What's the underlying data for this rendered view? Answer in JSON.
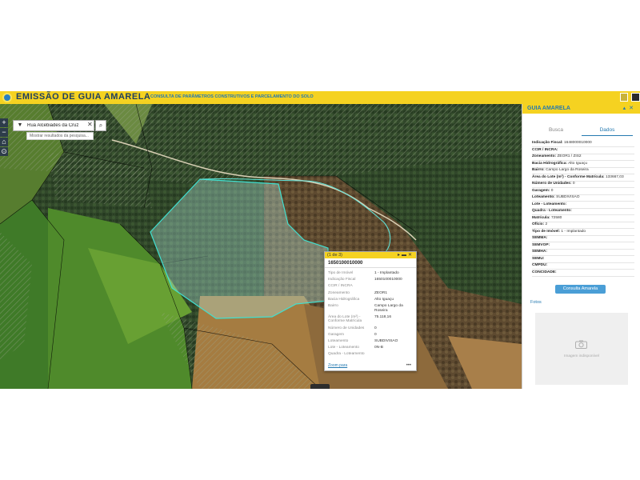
{
  "header": {
    "title": "EMISSÃO DE GUIA AMARELA",
    "subtitle": "CONSULTA DE PARÂMETROS CONSTRUTIVOS E PARCELAMENTO DO SOLO"
  },
  "map_controls": [
    "+",
    "−",
    "⌂",
    "⊙"
  ],
  "search": {
    "value": "Rua Alcebiades da Cruz",
    "hint": "Mostrar resultados da pesquisa..."
  },
  "popup": {
    "count": "(1 de 3)",
    "title": "1650100010000",
    "rows": [
      {
        "label": "Tipo de Imóvel",
        "value": "1 - Implantado"
      },
      {
        "label": "Indicação Fiscal",
        "value": "1650100010000"
      },
      {
        "label": "CCIR / INCRA",
        "value": ""
      },
      {
        "label": "Zoneamento",
        "value": "ZEOR1"
      },
      {
        "label": "Bacia Hidrográfica",
        "value": "Alto Iguaçu"
      },
      {
        "label": "Bairro",
        "value": "Campo Largo da Roseira"
      },
      {
        "label": "Área do Lote (m²) - Conforme Matrícula",
        "value": "75.118,16"
      },
      {
        "label": "Número de Unidades",
        "value": "0"
      },
      {
        "label": "Garagem",
        "value": "0"
      },
      {
        "label": "Loteamento",
        "value": "SUBDIVISAO"
      },
      {
        "label": "Lote - Loteamento",
        "value": "0N-B"
      },
      {
        "label": "Quadra - Loteamento",
        "value": ""
      }
    ],
    "zoom_link": "Zoom para",
    "more": "•••"
  },
  "panel": {
    "title": "GUIA AMARELA",
    "tabs": [
      "Busca",
      "Dados"
    ],
    "details": [
      {
        "key": "Indicação Fiscal:",
        "value": " 1648000010000"
      },
      {
        "key": "CCIR / INCRA:",
        "value": ""
      },
      {
        "key": "Zoneamento:",
        "value": " ZEOR1 / ZIS2"
      },
      {
        "key": "Bacia Hidrográfica:",
        "value": " Alto Iguaçu"
      },
      {
        "key": "Bairro:",
        "value": " Campo Largo da Roseira"
      },
      {
        "key": "Área do Lote (m²) - Conforme Matrícula:",
        "value": " 133667,03"
      },
      {
        "key": "Número de Unidades:",
        "value": " 0"
      },
      {
        "key": "Garagem:",
        "value": " 0"
      },
      {
        "key": "Loteamento:",
        "value": " SUBDIVISAO"
      },
      {
        "key": "Lote - Loteamento:",
        "value": ""
      },
      {
        "key": "Quadra - Loteamento:",
        "value": ""
      },
      {
        "key": "Matrícula:",
        "value": " 72580"
      },
      {
        "key": "Ofício:",
        "value": " 2"
      },
      {
        "key": "Tipo de Imóvel:",
        "value": " 1 - Implantado"
      },
      {
        "key": "SEMMA:",
        "value": ""
      },
      {
        "key": "SEMVOP:",
        "value": ""
      },
      {
        "key": "SEMHA:",
        "value": ""
      },
      {
        "key": "SEMU:",
        "value": ""
      },
      {
        "key": "CMPDU:",
        "value": ""
      },
      {
        "key": "CONCIDADE:",
        "value": ""
      }
    ],
    "consulta_button": "Consulta Amarela",
    "fotos_label": "Fotos",
    "no_image": "Imagem indisponível"
  },
  "colors": {
    "header_yellow": "#f5d221",
    "accent_blue": "#2479b0",
    "button_blue": "#4a9ed6",
    "selection_cyan": "#40e0d0"
  }
}
